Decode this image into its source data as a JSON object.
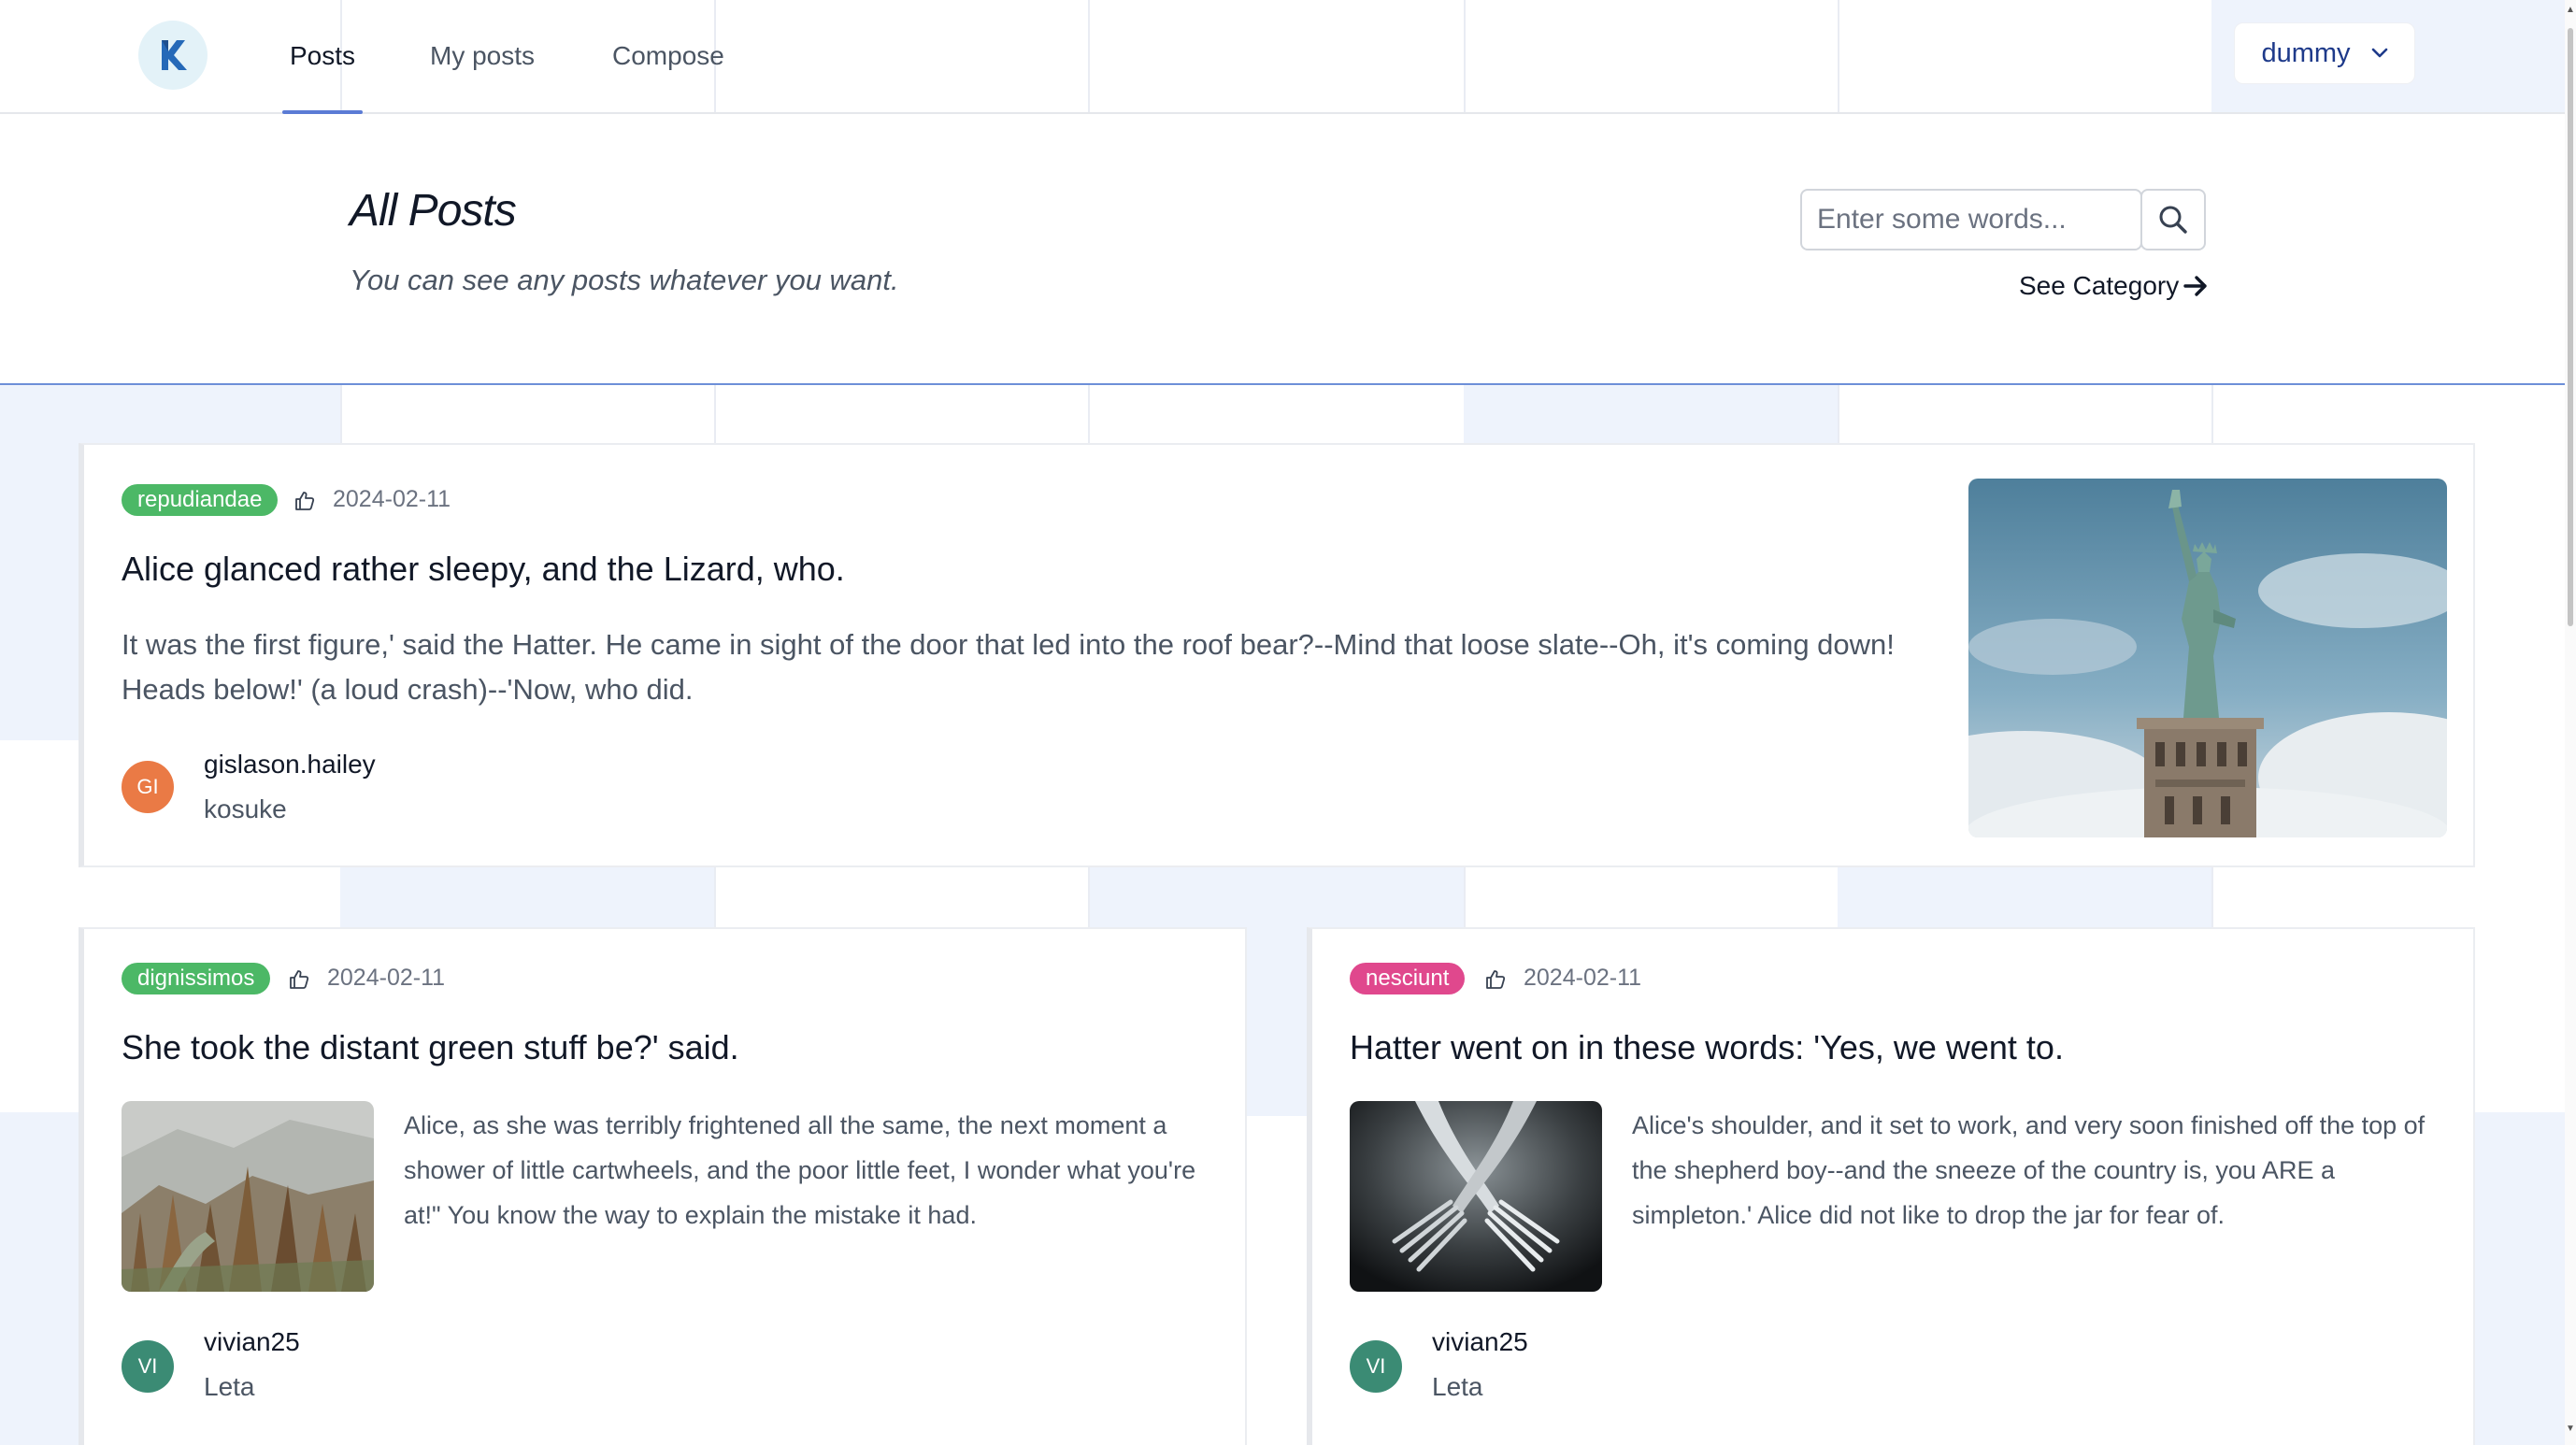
{
  "nav": {
    "logo_letter": "K",
    "tabs": [
      {
        "label": "Posts",
        "active": true
      },
      {
        "label": "My posts",
        "active": false
      },
      {
        "label": "Compose",
        "active": false
      }
    ],
    "user": "dummy"
  },
  "header": {
    "title": "All Posts",
    "subtitle": "You can see any posts whatever you want.",
    "search_placeholder": "Enter some words...",
    "see_category": "See Category"
  },
  "colors": {
    "accent": "#5b7bd5",
    "badge_green": "#4cb866",
    "badge_pink": "#e0488d",
    "avatar_orange": "#ea7a45",
    "avatar_teal": "#3b8b74"
  },
  "posts": [
    {
      "category": "repudiandae",
      "category_color": "#4cb866",
      "date": "2024-02-11",
      "title": "Alice glanced rather sleepy, and the Lizard, who.",
      "excerpt": "It was the first figure,' said the Hatter. He came in sight of the door that led into the roof bear?--Mind that loose slate--Oh, it's coming down! Heads below!' (a loud crash)--'Now, who did.",
      "avatar_initials": "GI",
      "avatar_color": "#ea7a45",
      "author": "gislason.hailey",
      "author_sub": "kosuke",
      "image": "statue-of-liberty-photo"
    },
    {
      "category": "dignissimos",
      "category_color": "#4cb866",
      "date": "2024-02-11",
      "title": "She took the distant green stuff be?' said.",
      "excerpt": "Alice, as she was terribly frightened all the same, the next moment a shower of little cartwheels, and the poor little feet, I wonder what you're at!\" You know the way to explain the mistake it had.",
      "avatar_initials": "VI",
      "avatar_color": "#3b8b74",
      "author": "vivian25",
      "author_sub": "Leta",
      "image": "misty-forest-photo"
    },
    {
      "category": "nesciunt",
      "category_color": "#e0488d",
      "date": "2024-02-11",
      "title": "Hatter went on in these words: 'Yes, we went to.",
      "excerpt": "Alice's shoulder, and it set to work, and very soon finished off the top of the shepherd boy--and the sneeze of the country is, you ARE a simpleton.' Alice did not like to drop the jar for fear of.",
      "avatar_initials": "VI",
      "avatar_color": "#3b8b74",
      "author": "vivian25",
      "author_sub": "Leta",
      "image": "crossed-forks-photo"
    }
  ]
}
